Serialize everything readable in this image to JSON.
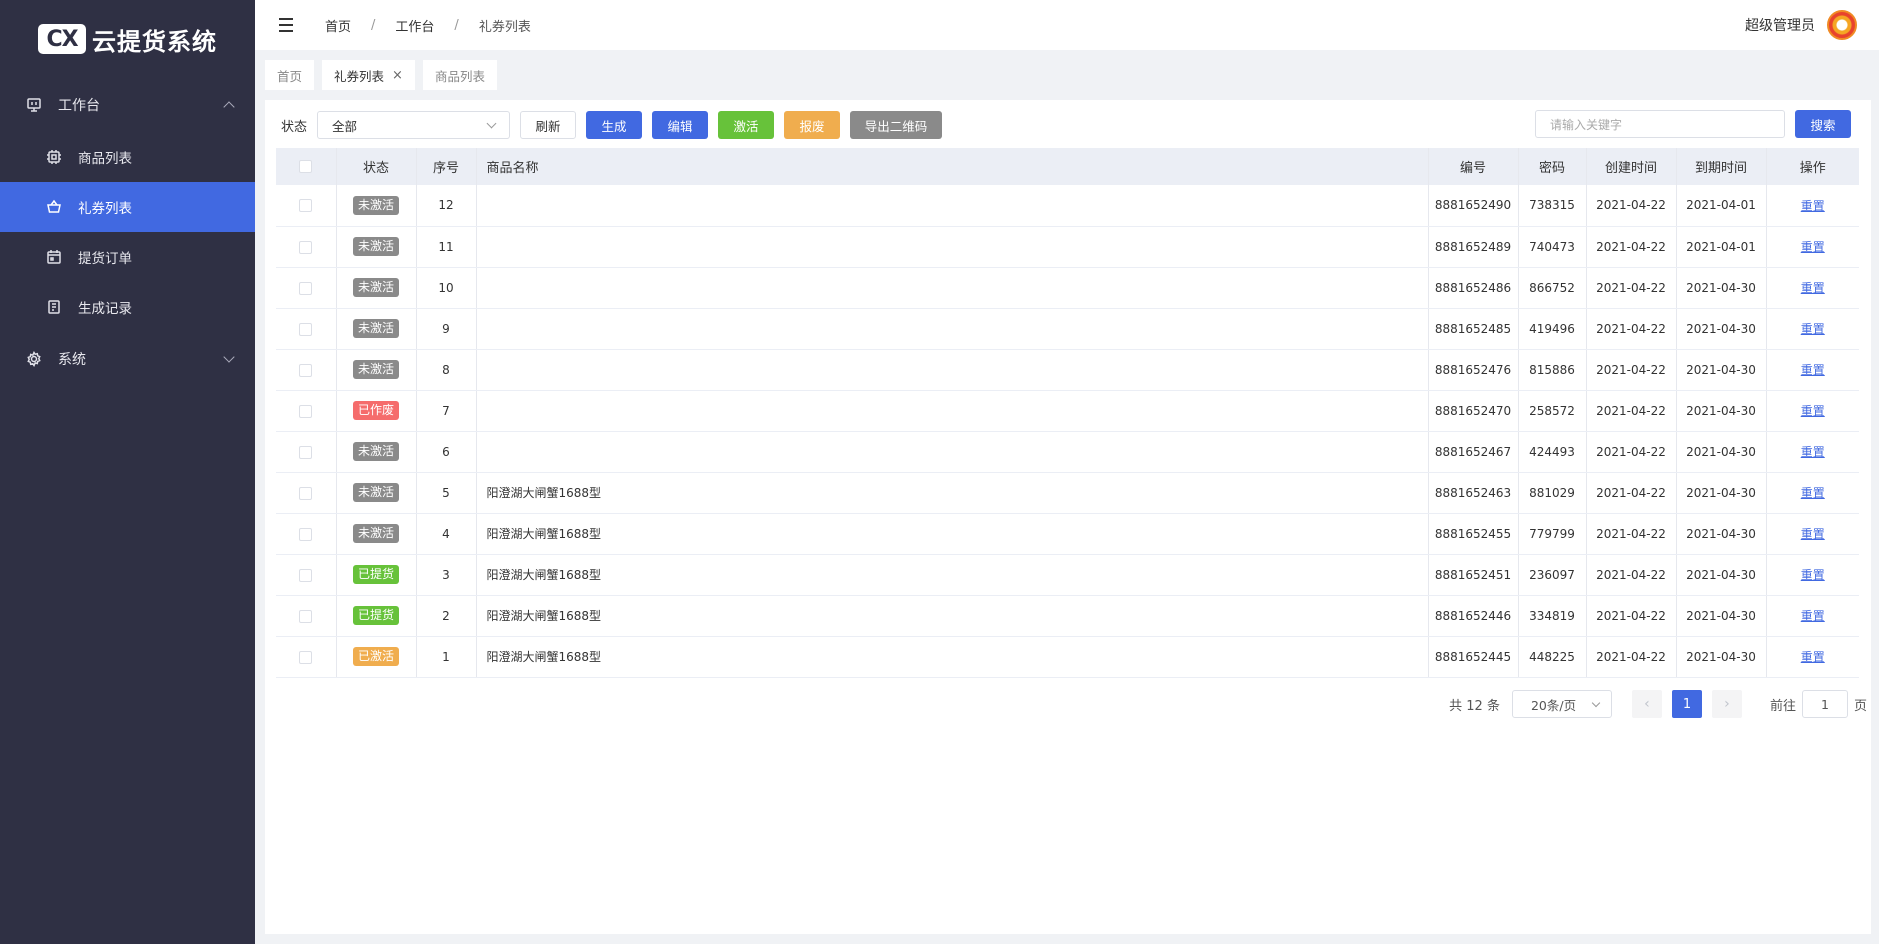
{
  "app": {
    "logo_mark": "CX",
    "logo_text": "云提货系统"
  },
  "sidebar": {
    "groups": [
      {
        "label": "工作台",
        "expanded": true
      },
      {
        "label": "系统",
        "expanded": false
      }
    ],
    "items": [
      {
        "label": "商品列表",
        "icon": "chip-icon"
      },
      {
        "label": "礼券列表",
        "icon": "basket-icon",
        "active": true
      },
      {
        "label": "提货订单",
        "icon": "calendar-icon"
      },
      {
        "label": "生成记录",
        "icon": "document-icon"
      }
    ]
  },
  "header": {
    "breadcrumb": [
      "首页",
      "工作台",
      "礼券列表"
    ],
    "separator": "/",
    "username": "超级管理员"
  },
  "tabs": [
    {
      "label": "首页"
    },
    {
      "label": "礼券列表",
      "active": true,
      "close": "×"
    },
    {
      "label": "商品列表"
    }
  ],
  "toolbar": {
    "status_label": "状态",
    "status_value": "全部",
    "refresh": "刷新",
    "generate": "生成",
    "edit": "编辑",
    "activate": "激活",
    "void": "报废",
    "export_qr": "导出二维码",
    "search_placeholder": "请输入关键字",
    "search": "搜索"
  },
  "table": {
    "columns": [
      "状态",
      "序号",
      "商品名称",
      "编号",
      "密码",
      "创建时间",
      "到期时间",
      "操作"
    ],
    "action_label": "重置",
    "rows": [
      {
        "status": "未激活",
        "color": "gray",
        "seq": "12",
        "name": "",
        "code": "8881652490",
        "pwd": "738315",
        "created": "2021-04-22",
        "expire": "2021-04-01"
      },
      {
        "status": "未激活",
        "color": "gray",
        "seq": "11",
        "name": "",
        "code": "8881652489",
        "pwd": "740473",
        "created": "2021-04-22",
        "expire": "2021-04-01"
      },
      {
        "status": "未激活",
        "color": "gray",
        "seq": "10",
        "name": "",
        "code": "8881652486",
        "pwd": "866752",
        "created": "2021-04-22",
        "expire": "2021-04-30"
      },
      {
        "status": "未激活",
        "color": "gray",
        "seq": "9",
        "name": "",
        "code": "8881652485",
        "pwd": "419496",
        "created": "2021-04-22",
        "expire": "2021-04-30"
      },
      {
        "status": "未激活",
        "color": "gray",
        "seq": "8",
        "name": "",
        "code": "8881652476",
        "pwd": "815886",
        "created": "2021-04-22",
        "expire": "2021-04-30"
      },
      {
        "status": "已作废",
        "color": "red",
        "seq": "7",
        "name": "",
        "code": "8881652470",
        "pwd": "258572",
        "created": "2021-04-22",
        "expire": "2021-04-30"
      },
      {
        "status": "未激活",
        "color": "gray",
        "seq": "6",
        "name": "",
        "code": "8881652467",
        "pwd": "424493",
        "created": "2021-04-22",
        "expire": "2021-04-30"
      },
      {
        "status": "未激活",
        "color": "gray",
        "seq": "5",
        "name": "阳澄湖大闸蟹1688型",
        "code": "8881652463",
        "pwd": "881029",
        "created": "2021-04-22",
        "expire": "2021-04-30"
      },
      {
        "status": "未激活",
        "color": "gray",
        "seq": "4",
        "name": "阳澄湖大闸蟹1688型",
        "code": "8881652455",
        "pwd": "779799",
        "created": "2021-04-22",
        "expire": "2021-04-30"
      },
      {
        "status": "已提货",
        "color": "green",
        "seq": "3",
        "name": "阳澄湖大闸蟹1688型",
        "code": "8881652451",
        "pwd": "236097",
        "created": "2021-04-22",
        "expire": "2021-04-30"
      },
      {
        "status": "已提货",
        "color": "green",
        "seq": "2",
        "name": "阳澄湖大闸蟹1688型",
        "code": "8881652446",
        "pwd": "334819",
        "created": "2021-04-22",
        "expire": "2021-04-30"
      },
      {
        "status": "已激活",
        "color": "orange",
        "seq": "1",
        "name": "阳澄湖大闸蟹1688型",
        "code": "8881652445",
        "pwd": "448225",
        "created": "2021-04-22",
        "expire": "2021-04-30"
      }
    ]
  },
  "pagination": {
    "total": "共 12 条",
    "page_size": "20条/页",
    "current": "1",
    "prev": "‹",
    "next": "›",
    "goto_prefix": "前往",
    "goto_value": "1",
    "goto_suffix": "页"
  },
  "colors": {
    "sidebar": "#2f3044",
    "primary": "#4169e1",
    "success": "#67c23a",
    "warning": "#f0ad4e",
    "danger": "#f56c6c",
    "neutral": "#8a8a8a"
  }
}
